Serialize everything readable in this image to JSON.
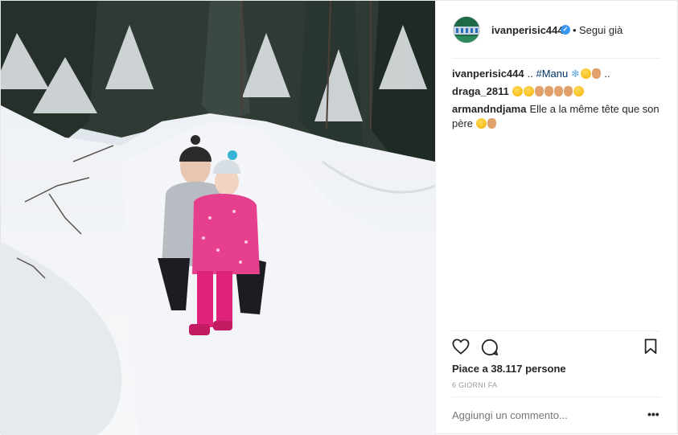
{
  "post": {
    "author": "ivanperisic444",
    "follow_label": "Segui già",
    "separator": "•",
    "comments": [
      {
        "user": "ivanperisic444",
        "text": "..",
        "tag": "#Manu",
        "tail": ".."
      },
      {
        "user": "draga_2811",
        "text": ""
      },
      {
        "user": "armandndjama",
        "text": "Elle a la même tête que son père"
      }
    ],
    "likes_label": "Piace a 38.117 persone",
    "timestamp": "6 GIORNI FA",
    "comment_placeholder": "Aggiungi un commento...",
    "more_label": "•••"
  },
  "icons": {
    "like": "heart-outline-icon",
    "comment": "speech-bubble-icon",
    "save": "bookmark-icon",
    "verified": "verified-badge-icon"
  },
  "colors": {
    "text": "#262626",
    "muted": "#999999",
    "verified": "#3897f0",
    "hashtag": "#003569"
  }
}
